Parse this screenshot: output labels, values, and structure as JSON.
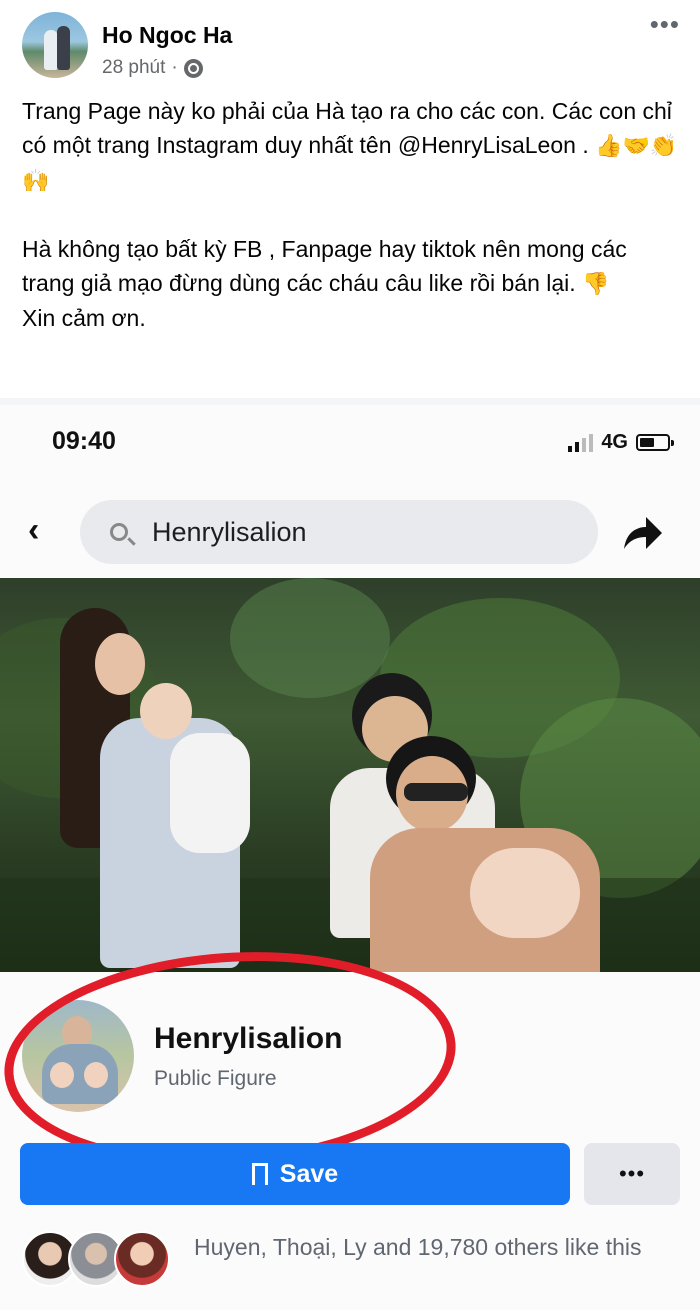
{
  "post": {
    "author": "Ho Ngoc Ha",
    "time": "28 phút",
    "separator": "·",
    "audience_icon": "globe-icon",
    "more_label": "•••",
    "paragraphs": [
      "Trang Page này ko phải của Hà tạo ra cho các con. Các con chỉ có một trang Instagram duy nhất tên @HenryLisaLeon .",
      "Hà không tạo bất kỳ FB , Fanpage hay tiktok nên mong các trang giả mạo đừng dùng các cháu câu like rồi bán lại.",
      "Xin cảm ơn."
    ],
    "emoji_line1": "👍🤝👏🙌",
    "emoji_line2": "👎"
  },
  "screenshot": {
    "time": "09:40",
    "network": "4G",
    "search_query": "Henrylisalion",
    "back_icon": "chevron-left-icon",
    "share_icon": "share-arrow-icon",
    "page_name": "Henrylisalion",
    "page_type": "Public Figure",
    "save_label": "Save",
    "more_label": "•••",
    "likes_text": "Huyen, Thoại, Ly and 19,780 others like this",
    "highlight_color": "#e11d2a",
    "accent_color": "#1877f2"
  }
}
